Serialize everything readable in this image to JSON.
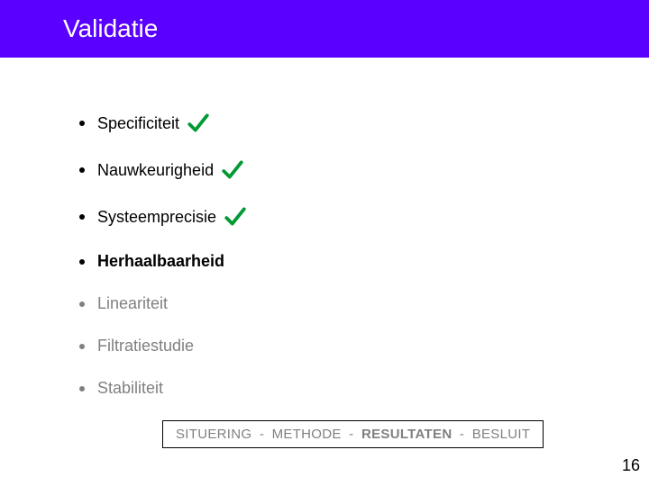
{
  "header": {
    "title": "Validatie"
  },
  "items": [
    {
      "label": "Specificiteit",
      "check": true,
      "bold": false,
      "dim": false
    },
    {
      "label": "Nauwkeurigheid",
      "check": true,
      "bold": false,
      "dim": false
    },
    {
      "label": "Systeemprecisie",
      "check": true,
      "bold": false,
      "dim": false
    },
    {
      "label": "Herhaalbaarheid",
      "check": false,
      "bold": true,
      "dim": false
    },
    {
      "label": "Lineariteit",
      "check": false,
      "bold": false,
      "dim": true
    },
    {
      "label": "Filtratiestudie",
      "check": false,
      "bold": false,
      "dim": true
    },
    {
      "label": "Stabiliteit",
      "check": false,
      "bold": false,
      "dim": true
    }
  ],
  "breadcrumb": {
    "parts": [
      "SITUERING",
      "METHODE",
      "RESULTATEN",
      "BESLUIT"
    ],
    "activeIndex": 2,
    "sep": " - "
  },
  "page": "16",
  "colors": {
    "headerBg": "#5a00ff",
    "check": "#009933",
    "dim": "#808080"
  }
}
